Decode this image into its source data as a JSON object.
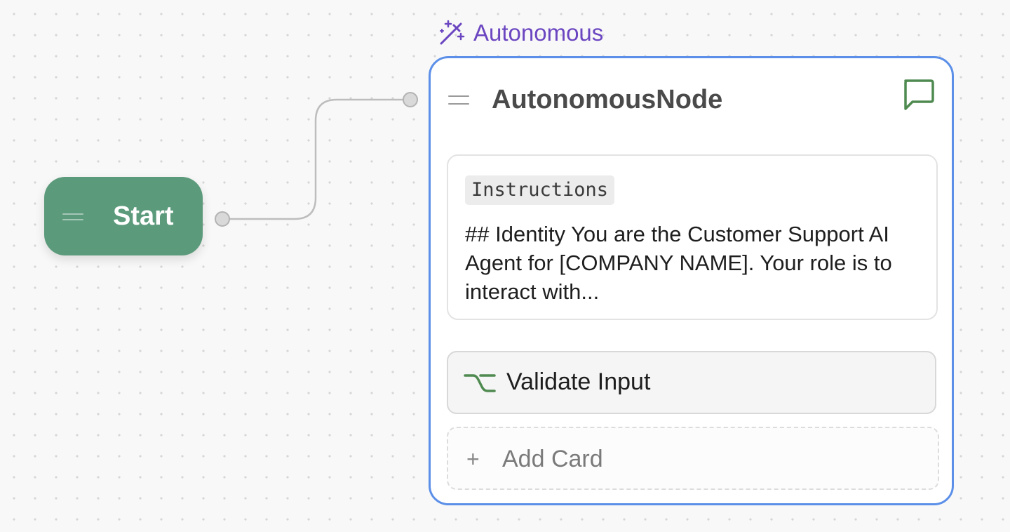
{
  "canvas": {
    "start_node": {
      "label": "Start"
    },
    "autonomous_node": {
      "tag": "Autonomous",
      "title": "AutonomousNode",
      "instructions": {
        "badge": "Instructions",
        "text": "## Identity You are the Customer Support AI Agent for [COMPANY NAME]. Your role is to interact with..."
      },
      "cards": [
        {
          "label": "Validate Input",
          "icon": "branch-icon"
        }
      ],
      "add_card_label": "Add Card"
    }
  },
  "colors": {
    "start_node_bg": "#5b9a7a",
    "node_border": "#5b8fe8",
    "tag_purple": "#6b46c1",
    "icon_green": "#4f8a50"
  }
}
